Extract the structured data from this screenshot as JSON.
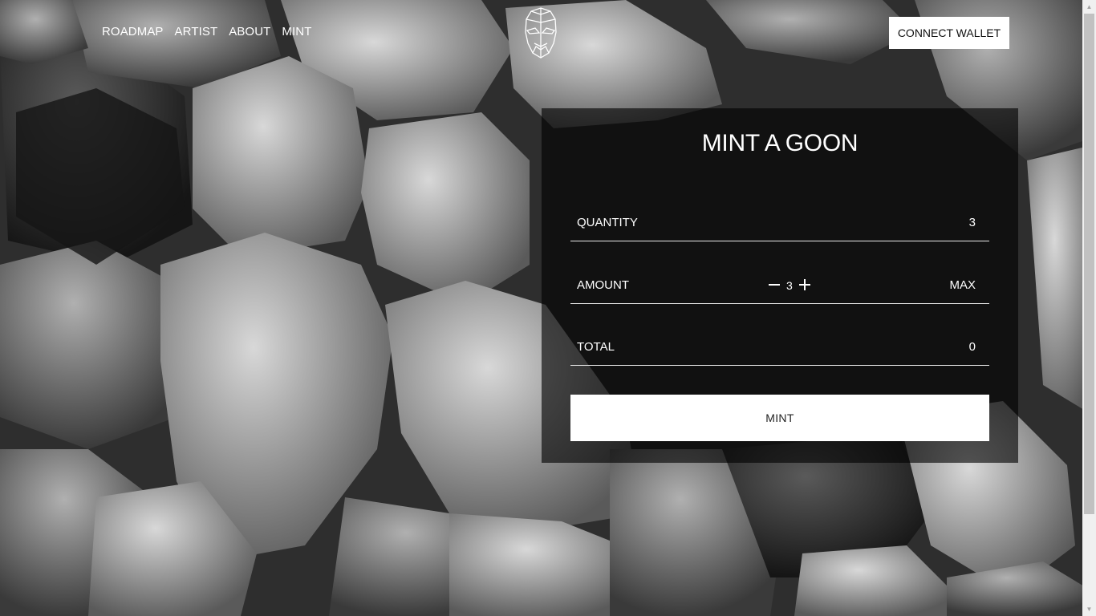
{
  "nav": {
    "items": [
      {
        "label": "ROADMAP"
      },
      {
        "label": "ARTIST"
      },
      {
        "label": "ABOUT"
      },
      {
        "label": "MINT"
      }
    ]
  },
  "header": {
    "logo_icon": "goon-head-wireframe-icon",
    "connect_label": "CONNECT WALLET"
  },
  "mint_panel": {
    "title": "MINT A GOON",
    "quantity": {
      "label": "QUANTITY",
      "value": "3"
    },
    "amount": {
      "label": "AMOUNT",
      "decrement_icon": "minus-icon",
      "value": "3",
      "increment_icon": "plus-icon",
      "max_label": "MAX"
    },
    "total": {
      "label": "TOTAL",
      "value": "0"
    },
    "mint_label": "MINT"
  },
  "colors": {
    "panel_bg": "#000000",
    "button_bg": "#ffffff",
    "text": "#ffffff"
  }
}
